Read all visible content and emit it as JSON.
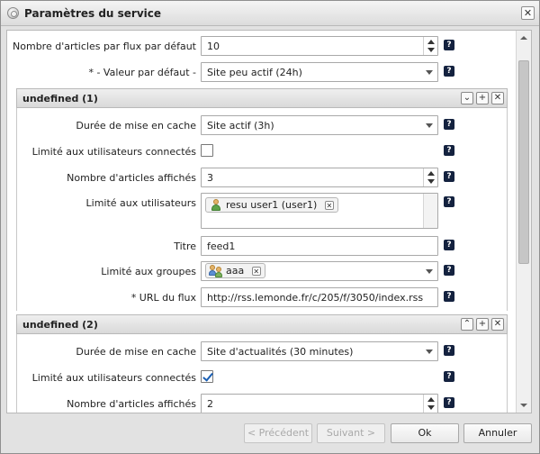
{
  "dialog": {
    "title": "Paramètres du service",
    "close_label": "✕"
  },
  "top_fields": {
    "articles_per_feed_label": "Nombre d'articles par flux par défaut",
    "articles_per_feed_value": "10",
    "default_value_label": "* - Valeur par défaut -",
    "default_value_value": "Site peu actif (24h)"
  },
  "sections": [
    {
      "title": "undefined (1)",
      "cache_label": "Durée de mise en cache",
      "cache_value": "Site actif (3h)",
      "limit_connected_label": "Limité aux utilisateurs connectés",
      "limit_connected_checked": false,
      "articles_shown_label": "Nombre d'articles affichés",
      "articles_shown_value": "3",
      "limit_users_label": "Limité aux utilisateurs",
      "user_tag": "resu user1 (user1)",
      "title_label": "Titre",
      "title_value": "feed1",
      "limit_groups_label": "Limité aux groupes",
      "group_tag": "aaa",
      "url_label": "* URL du flux",
      "url_value": "http://rss.lemonde.fr/c/205/f/3050/index.rss"
    },
    {
      "title": "undefined (2)",
      "cache_label": "Durée de mise en cache",
      "cache_value": "Site d'actualités (30 minutes)",
      "limit_connected_label": "Limité aux utilisateurs connectés",
      "limit_connected_checked": true,
      "articles_shown_label": "Nombre d'articles affichés",
      "articles_shown_value": "2"
    }
  ],
  "help_glyph": "?",
  "section_buttons": {
    "collapse": "⌄",
    "expand": "⌃",
    "add": "+",
    "remove": "✕"
  },
  "tag_remove_glyph": "✕",
  "footer": {
    "previous_label": "< Précédent",
    "next_label": "Suivant >",
    "ok_label": "Ok",
    "cancel_label": "Annuler"
  },
  "icons": {
    "title": "service-settings-icon",
    "user": "user-icon",
    "group": "group-icon"
  }
}
